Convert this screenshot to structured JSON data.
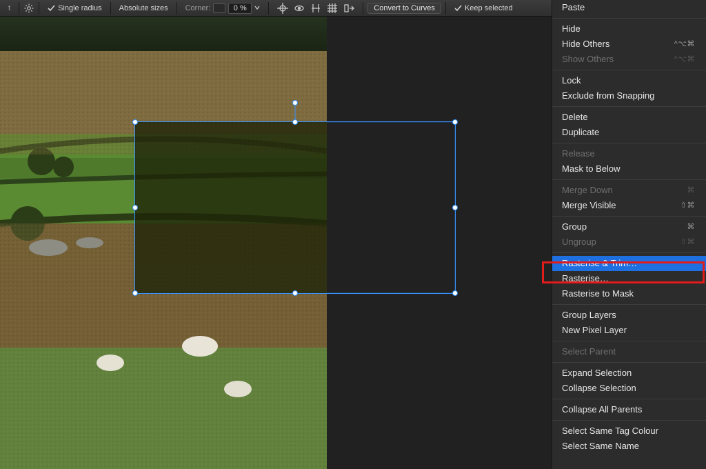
{
  "toolbar": {
    "single_radius": "Single radius",
    "absolute_sizes": "Absolute sizes",
    "corner_label": "Corner:",
    "corner_pct": "0 %",
    "convert": "Convert to Curves",
    "keep_selected": "Keep selected"
  },
  "selection": {
    "handles": [
      "tl",
      "tm",
      "tr",
      "ml",
      "mr",
      "bl",
      "bm",
      "br",
      "rot"
    ]
  },
  "context_menu": {
    "groups": [
      [
        {
          "label": "Paste",
          "shortcut": "",
          "enabled": true
        }
      ],
      [
        {
          "label": "Hide",
          "shortcut": "",
          "enabled": true
        },
        {
          "label": "Hide Others",
          "shortcut": "^⌥⌘",
          "enabled": true
        },
        {
          "label": "Show Others",
          "shortcut": "^⌥⌘",
          "enabled": false
        }
      ],
      [
        {
          "label": "Lock",
          "shortcut": "",
          "enabled": true
        },
        {
          "label": "Exclude from Snapping",
          "shortcut": "",
          "enabled": true
        }
      ],
      [
        {
          "label": "Delete",
          "shortcut": "",
          "enabled": true
        },
        {
          "label": "Duplicate",
          "shortcut": "",
          "enabled": true
        }
      ],
      [
        {
          "label": "Release",
          "shortcut": "",
          "enabled": false
        },
        {
          "label": "Mask to Below",
          "shortcut": "",
          "enabled": true
        }
      ],
      [
        {
          "label": "Merge Down",
          "shortcut": "⌘",
          "enabled": false
        },
        {
          "label": "Merge Visible",
          "shortcut": "⇧⌘",
          "enabled": true
        }
      ],
      [
        {
          "label": "Group",
          "shortcut": "⌘",
          "enabled": true
        },
        {
          "label": "Ungroup",
          "shortcut": "⇧⌘",
          "enabled": false
        }
      ],
      [
        {
          "label": "Rasterise & Trim…",
          "shortcut": "",
          "enabled": true,
          "selected": true
        },
        {
          "label": "Rasterise…",
          "shortcut": "",
          "enabled": true
        },
        {
          "label": "Rasterise to Mask",
          "shortcut": "",
          "enabled": true
        }
      ],
      [
        {
          "label": "Group Layers",
          "shortcut": "",
          "enabled": true
        },
        {
          "label": "New Pixel Layer",
          "shortcut": "",
          "enabled": true
        }
      ],
      [
        {
          "label": "Select Parent",
          "shortcut": "",
          "enabled": false
        }
      ],
      [
        {
          "label": "Expand Selection",
          "shortcut": "",
          "enabled": true
        },
        {
          "label": "Collapse Selection",
          "shortcut": "",
          "enabled": true
        }
      ],
      [
        {
          "label": "Collapse All Parents",
          "shortcut": "",
          "enabled": true
        }
      ],
      [
        {
          "label": "Select Same Tag Colour",
          "shortcut": "",
          "enabled": true
        },
        {
          "label": "Select Same Name",
          "shortcut": "",
          "enabled": true
        }
      ]
    ]
  }
}
